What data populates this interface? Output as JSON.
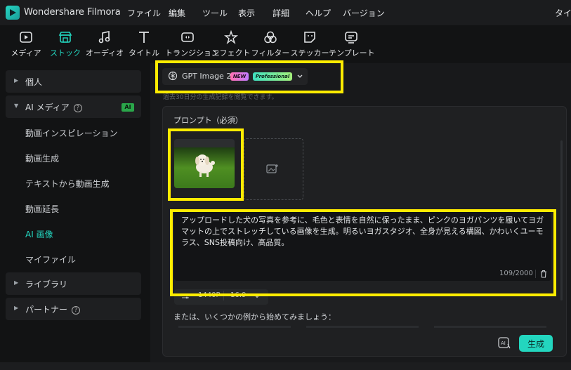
{
  "app": {
    "title": "Wondershare Filmora"
  },
  "menu": {
    "items": [
      {
        "label": "ファイル"
      },
      {
        "label": "編集"
      },
      {
        "label": "ツール"
      },
      {
        "label": "表示"
      },
      {
        "label": "詳細"
      },
      {
        "label": "ヘルプ"
      },
      {
        "label": "バージョン"
      }
    ],
    "right_label": "タイト"
  },
  "toolbar": {
    "items": [
      {
        "label": "メディア",
        "icon": "media-icon"
      },
      {
        "label": "ストック",
        "icon": "stock-icon",
        "active": true
      },
      {
        "label": "オーディオ",
        "icon": "audio-icon"
      },
      {
        "label": "タイトル",
        "icon": "title-icon"
      },
      {
        "label": "トランジション",
        "icon": "transition-icon"
      },
      {
        "label": "エフェクト",
        "icon": "effect-icon"
      },
      {
        "label": "フィルター",
        "icon": "filter-icon"
      },
      {
        "label": "ステッカー",
        "icon": "sticker-icon"
      },
      {
        "label": "テンプレート",
        "icon": "template-icon"
      }
    ],
    "accent": "#23d6bf"
  },
  "sidebar": {
    "group_personal": "個人",
    "group_ai_media": "AI メディア",
    "ai_badge": "AI",
    "sub_items": [
      {
        "label": "動画インスピレーション"
      },
      {
        "label": "動画生成"
      },
      {
        "label": "テキストから動画生成"
      },
      {
        "label": "動画延長"
      },
      {
        "label": "AI 画像",
        "selected": true
      },
      {
        "label": "マイファイル"
      }
    ],
    "group_library": "ライブラリ",
    "group_partner": "パートナー"
  },
  "model": {
    "name": "GPT Image 2",
    "badge_new": "NEW",
    "badge_pro": "Professional"
  },
  "history_note": "過去30日分の生成記録を閲覧できます。",
  "prompt": {
    "label": "プロンプト（必須）",
    "text": "アップロードした犬の写真を参考に、毛色と表情を自然に保ったまま、ピンクのヨガパンツを履いてヨガマットの上でストレッチしている画像を生成。明るいヨガスタジオ、全身が見える構図、かわいくユーモラス、SNS投稿向け、高品質。",
    "char_count": "109/2000"
  },
  "settings": {
    "resolution": "1440P",
    "ratio": "16:9"
  },
  "examples_label": "または、いくつかの例から始めてみましょう：",
  "generate_label": "生成",
  "highlight_color": "#ffec00"
}
